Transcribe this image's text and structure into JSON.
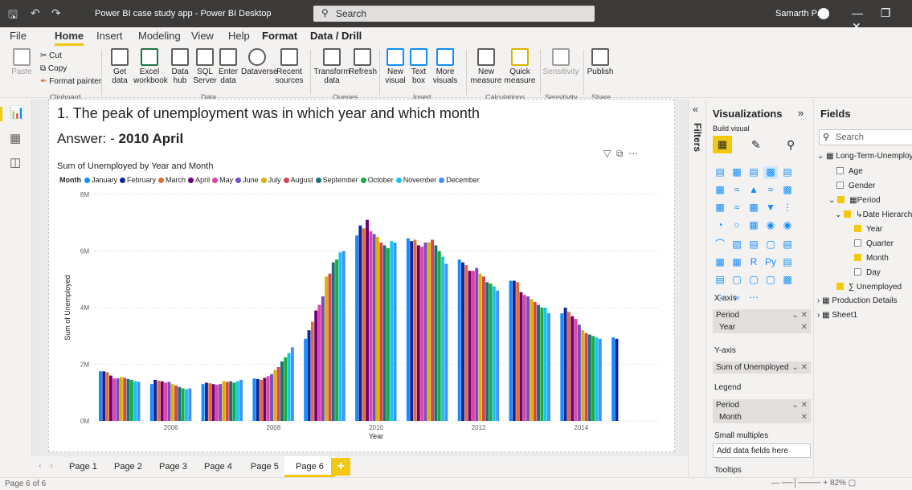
{
  "titlebar": {
    "title": "Power BI case study app - Power BI Desktop",
    "search_placeholder": "Search",
    "user": "Samarth Patil"
  },
  "menu": [
    "File",
    "Home",
    "Insert",
    "Modeling",
    "View",
    "Help",
    "Format",
    "Data / Drill"
  ],
  "ribbon": {
    "clipboard": {
      "paste": "Paste",
      "cut": "Cut",
      "copy": "Copy",
      "format_painter": "Format painter",
      "group": "Clipboard"
    },
    "data": {
      "items": [
        "Get data",
        "Excel workbook",
        "Data hub",
        "SQL Server",
        "Enter data",
        "Dataverse",
        "Recent sources"
      ],
      "group": "Data"
    },
    "queries": {
      "items": [
        "Transform data",
        "Refresh"
      ],
      "group": "Queries"
    },
    "insert": {
      "items": [
        "New visual",
        "Text box",
        "More visuals"
      ],
      "group": "Insert"
    },
    "calculations": {
      "items": [
        "New measure",
        "Quick measure"
      ],
      "group": "Calculations"
    },
    "sensitivity": {
      "items": [
        "Sensitivity"
      ],
      "group": "Sensitivity"
    },
    "share": {
      "items": [
        "Publish"
      ],
      "group": "Share"
    }
  },
  "report": {
    "question": "1. The peak of unemployment was in which year and which month",
    "answer_prefix": "Answer: -",
    "answer_value": "2010 April"
  },
  "chart_data": {
    "type": "bar",
    "title": "Sum of Unemployed by Year and Month",
    "legend_title": "Month",
    "xlabel": "Year",
    "ylabel": "Sum of Unemployed",
    "ylim": [
      0,
      8000000
    ],
    "yticks": [
      "0M",
      "2M",
      "4M",
      "6M",
      "8M"
    ],
    "x_tick_labels": [
      "2006",
      "2008",
      "2010",
      "2012",
      "2014"
    ],
    "categories": [
      "2005",
      "2006",
      "2007",
      "2008",
      "2009",
      "2010",
      "2011",
      "2012",
      "2013",
      "2014",
      "2015"
    ],
    "grid": true,
    "legend_position": "top-left",
    "series": [
      {
        "name": "January",
        "color": "#118dff",
        "values": [
          1.75,
          1.3,
          1.3,
          1.5,
          2.9,
          6.55,
          6.45,
          5.7,
          4.95,
          3.8,
          2.95
        ]
      },
      {
        "name": "February",
        "color": "#12239e",
        "values": [
          1.75,
          1.45,
          1.35,
          1.48,
          3.2,
          6.9,
          6.35,
          5.6,
          4.95,
          4.0,
          2.9
        ]
      },
      {
        "name": "March",
        "color": "#e66c37",
        "values": [
          1.72,
          1.42,
          1.33,
          1.45,
          3.5,
          6.8,
          6.4,
          5.5,
          4.9,
          3.85,
          null
        ]
      },
      {
        "name": "April",
        "color": "#6b007b",
        "values": [
          1.6,
          1.4,
          1.3,
          1.52,
          3.9,
          7.1,
          6.2,
          5.3,
          4.55,
          3.7,
          null
        ]
      },
      {
        "name": "May",
        "color": "#e044a7",
        "values": [
          1.5,
          1.35,
          1.28,
          1.58,
          4.1,
          6.7,
          6.15,
          5.3,
          4.45,
          3.6,
          null
        ]
      },
      {
        "name": "June",
        "color": "#744ec2",
        "values": [
          1.5,
          1.38,
          1.3,
          1.65,
          4.4,
          6.6,
          6.3,
          5.4,
          4.4,
          3.4,
          null
        ]
      },
      {
        "name": "July",
        "color": "#d9b300",
        "values": [
          1.55,
          1.3,
          1.4,
          1.8,
          5.1,
          6.5,
          6.3,
          5.2,
          4.3,
          3.2,
          null
        ]
      },
      {
        "name": "August",
        "color": "#d64550",
        "values": [
          1.52,
          1.25,
          1.38,
          1.9,
          5.2,
          6.3,
          6.4,
          5.1,
          4.2,
          3.1,
          null
        ]
      },
      {
        "name": "September",
        "color": "#197278",
        "values": [
          1.48,
          1.2,
          1.4,
          2.1,
          5.6,
          6.2,
          6.2,
          4.9,
          4.1,
          3.05,
          null
        ]
      },
      {
        "name": "October",
        "color": "#1aab40",
        "values": [
          1.45,
          1.15,
          1.35,
          2.25,
          5.7,
          6.1,
          6.0,
          4.85,
          4.0,
          3.0,
          null
        ]
      },
      {
        "name": "November",
        "color": "#15c6f4",
        "values": [
          1.4,
          1.12,
          1.4,
          2.4,
          5.95,
          6.35,
          5.8,
          4.75,
          4.0,
          2.95,
          null
        ]
      },
      {
        "name": "December",
        "color": "#4092ff",
        "values": [
          1.38,
          1.15,
          1.45,
          2.6,
          6.0,
          6.3,
          5.55,
          4.6,
          3.8,
          2.9,
          null
        ]
      }
    ]
  },
  "page_tabs": [
    "Page 1",
    "Page 2",
    "Page 3",
    "Page 4",
    "Page 5",
    "Page 6"
  ],
  "active_tab": "Page 6",
  "status": {
    "page_info": "Page 6 of 6",
    "zoom": "82%"
  },
  "filters_label": "Filters",
  "visualizations": {
    "title": "Visualizations",
    "build_visual": "Build visual",
    "x_axis_label": "X-axis",
    "x_axis_fields": [
      "Period",
      "Year"
    ],
    "y_axis_label": "Y-axis",
    "y_axis_field": "Sum of Unemployed",
    "legend_label": "Legend",
    "legend_fields": [
      "Period",
      "Month"
    ],
    "small_multiples_label": "Small multiples",
    "small_multiples_placeholder": "Add data fields here",
    "tooltips_label": "Tooltips"
  },
  "fields": {
    "title": "Fields",
    "search_placeholder": "Search",
    "table1": "Long-Term-Unemploy...",
    "items": [
      {
        "label": "Age",
        "checked": false
      },
      {
        "label": "Gender",
        "checked": false
      },
      {
        "label": "Period",
        "checked": true
      },
      {
        "label": "Date Hierarchy",
        "checked": true
      },
      {
        "label": "Year",
        "checked": true
      },
      {
        "label": "Quarter",
        "checked": false
      },
      {
        "label": "Month",
        "checked": true
      },
      {
        "label": "Day",
        "checked": false
      },
      {
        "label": "Unemployed",
        "checked": true
      }
    ],
    "table2": "Production Details",
    "table3": "Sheet1"
  }
}
